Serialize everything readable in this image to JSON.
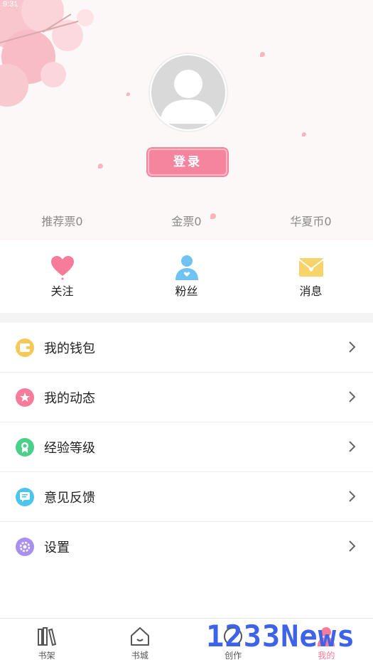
{
  "status": {
    "time": "9:31"
  },
  "profile": {
    "login_label": "登录"
  },
  "stats": [
    {
      "label": "推荐票0"
    },
    {
      "label": "金票0"
    },
    {
      "label": "华夏币0"
    }
  ],
  "quick_actions": [
    {
      "label": "关注",
      "icon": "heart-icon"
    },
    {
      "label": "粉丝",
      "icon": "person-icon"
    },
    {
      "label": "消息",
      "icon": "envelope-icon"
    }
  ],
  "menu": [
    {
      "label": "我的钱包",
      "icon": "wallet-icon",
      "color": "#f5c85a"
    },
    {
      "label": "我的动态",
      "icon": "star-icon",
      "color": "#f77b9a"
    },
    {
      "label": "经验等级",
      "icon": "medal-icon",
      "color": "#4ccf8a"
    },
    {
      "label": "意见反馈",
      "icon": "feedback-icon",
      "color": "#4bc4ef"
    },
    {
      "label": "设置",
      "icon": "gear-icon",
      "color": "#a98ff0"
    }
  ],
  "tabs": [
    {
      "label": "书架",
      "icon": "bookshelf-icon",
      "active": false
    },
    {
      "label": "书城",
      "icon": "house-icon",
      "active": false
    },
    {
      "label": "创作",
      "icon": "pen-icon",
      "active": false
    },
    {
      "label": "我的",
      "icon": "profile-icon",
      "active": true
    }
  ],
  "watermark": "1233News",
  "colors": {
    "accent": "#f5859f",
    "active_tab": "#f77b9a",
    "header_bg": "#fbf8f7"
  }
}
